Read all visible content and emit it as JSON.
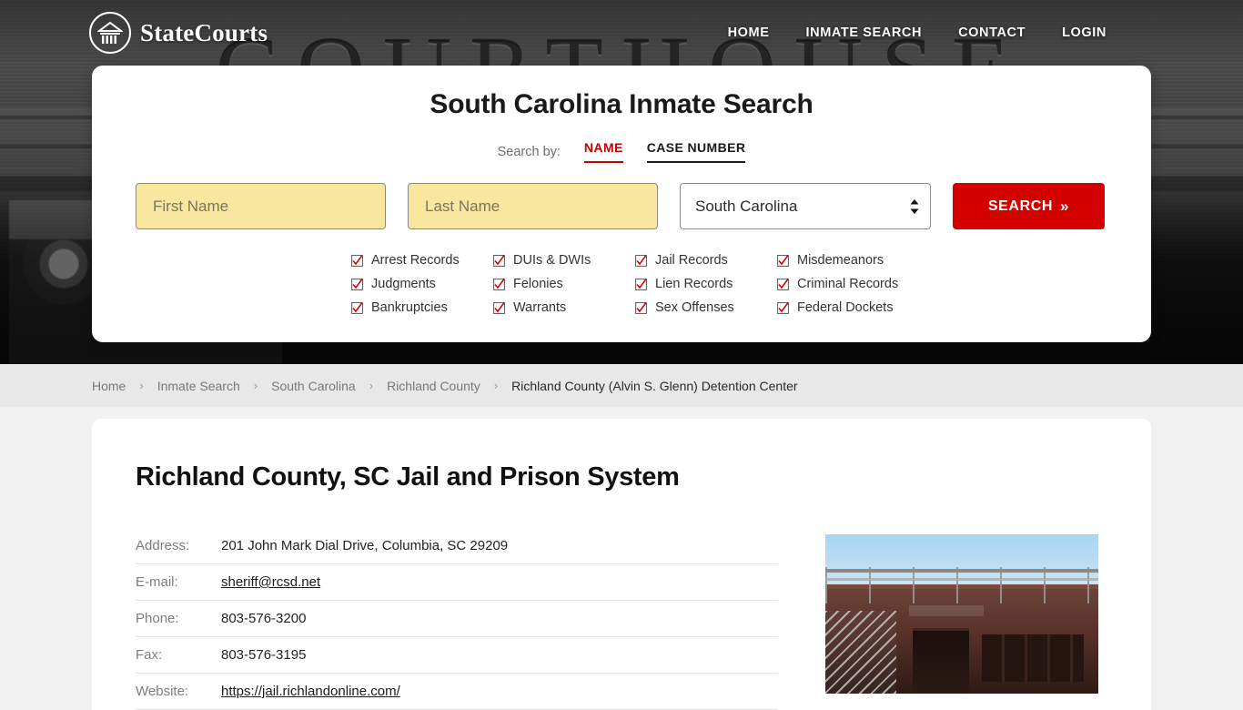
{
  "header": {
    "brand_name": "StateCourts",
    "logo_icon": "courthouse-circle-icon",
    "nav": [
      {
        "label": "HOME"
      },
      {
        "label": "INMATE SEARCH"
      },
      {
        "label": "CONTACT"
      },
      {
        "label": "LOGIN"
      }
    ]
  },
  "search_panel": {
    "title": "South Carolina Inmate Search",
    "search_by_label": "Search by:",
    "tabs": [
      {
        "label": "NAME",
        "active": true
      },
      {
        "label": "CASE NUMBER",
        "active": false
      }
    ],
    "first_name_placeholder": "First Name",
    "first_name_value": "",
    "last_name_placeholder": "Last Name",
    "last_name_value": "",
    "state_selected": "South Carolina",
    "state_options": [
      "South Carolina"
    ],
    "search_button_label": "SEARCH",
    "search_button_icon": "double-chevron-right-icon",
    "record_types": [
      "Arrest Records",
      "DUIs & DWIs",
      "Jail Records",
      "Misdemeanors",
      "Judgments",
      "Felonies",
      "Lien Records",
      "Criminal Records",
      "Bankruptcies",
      "Warrants",
      "Sex Offenses",
      "Federal Dockets"
    ],
    "checkbox_icon": "checked-checkbox-icon"
  },
  "breadcrumb": {
    "separator": "›",
    "items": [
      {
        "label": "Home",
        "current": false
      },
      {
        "label": "Inmate Search",
        "current": false
      },
      {
        "label": "South Carolina",
        "current": false
      },
      {
        "label": "Richland County",
        "current": false
      },
      {
        "label": "Richland County (Alvin S. Glenn) Detention Center",
        "current": true
      }
    ]
  },
  "main": {
    "page_title": "Richland County, SC Jail and Prison System",
    "details": [
      {
        "label": "Address:",
        "value": "201 John Mark Dial Drive, Columbia, SC 29209",
        "is_link": false
      },
      {
        "label": "E-mail:",
        "value": "sheriff@rcsd.net",
        "is_link": true
      },
      {
        "label": "Phone:",
        "value": "803-576-3200",
        "is_link": false
      },
      {
        "label": "Fax:",
        "value": "803-576-3195",
        "is_link": false
      },
      {
        "label": "Website:",
        "value": "https://jail.richlandonline.com/",
        "is_link": true
      }
    ],
    "facility_photo_alt": "Richland County Alvin S. Glenn Detention Center building"
  },
  "colors": {
    "accent_red": "#c70000",
    "button_red": "#d40000",
    "field_yellow": "#f9e79f",
    "page_bg": "#f1f1f1",
    "breadcrumb_bg": "#e8e8e8"
  },
  "hero": {
    "background_word": "COURTHOUSE"
  }
}
